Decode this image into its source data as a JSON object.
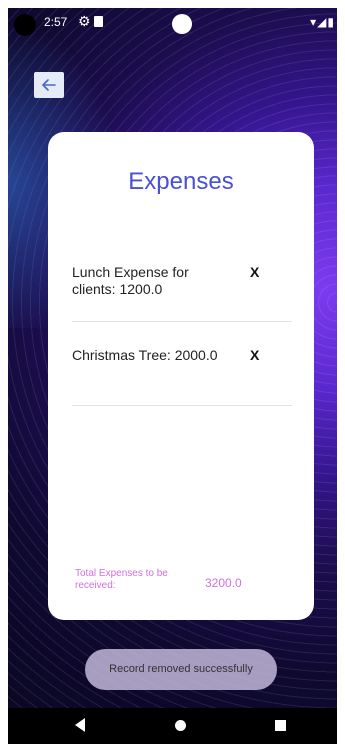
{
  "status_bar": {
    "time": "2:57"
  },
  "header": {
    "back_icon": "arrow-left-icon"
  },
  "card": {
    "title": "Expenses",
    "items": [
      {
        "text": "Lunch Expense for clients: 1200.0",
        "delete_label": "X"
      },
      {
        "text": "Christmas Tree: 2000.0",
        "delete_label": "X"
      }
    ],
    "total_label": "Total Expenses to be received:",
    "total_value": "3200.0"
  },
  "toast": {
    "message": "Record removed successfully"
  },
  "colors": {
    "title": "#4950d6",
    "total": "#d46fe0",
    "back_button_bg": "#e6ecf7"
  }
}
